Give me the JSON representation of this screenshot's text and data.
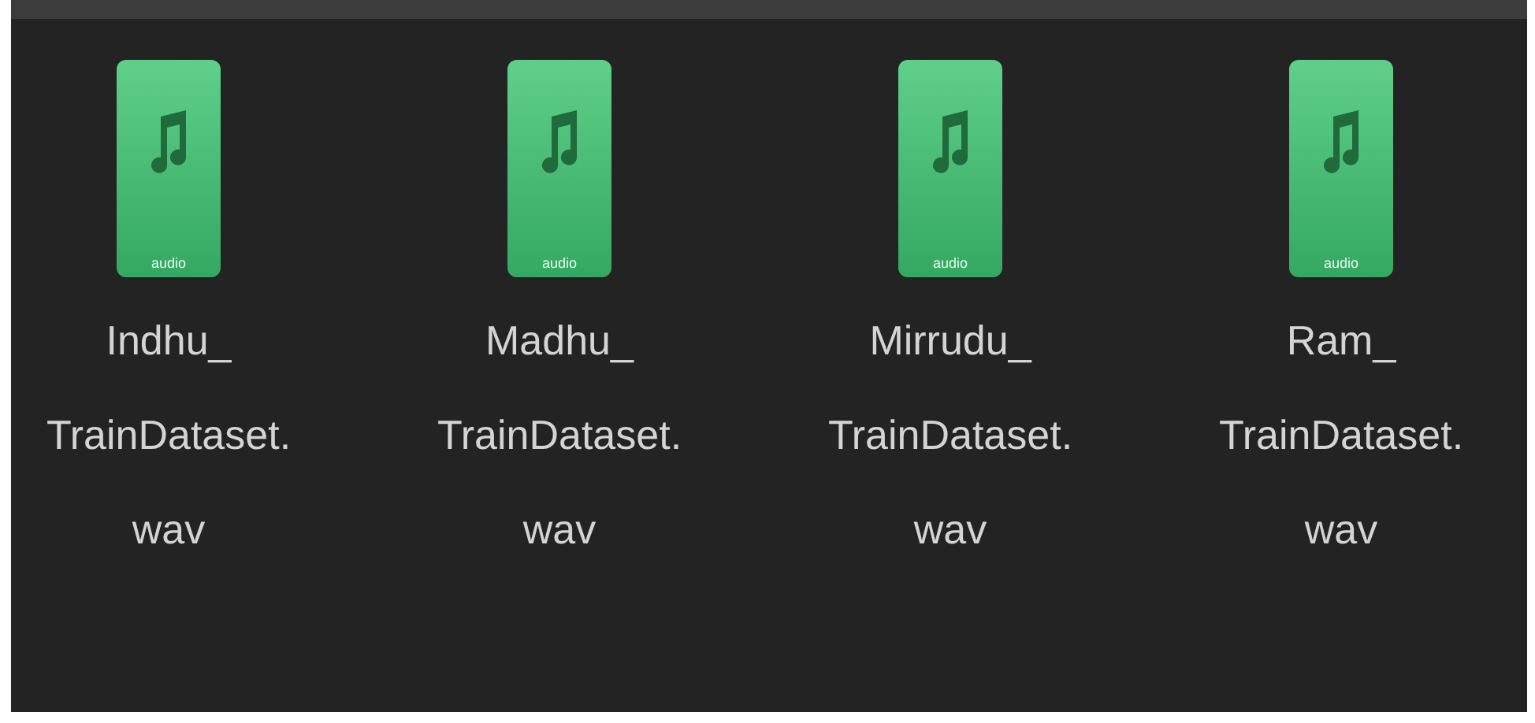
{
  "files": [
    {
      "name_lines": [
        "Indhu_",
        "TrainDataset.",
        "wav"
      ],
      "icon_label": "audio",
      "selected": false
    },
    {
      "name_lines": [
        "Madhu_",
        "TrainDataset.",
        "wav"
      ],
      "icon_label": "audio",
      "selected": false
    },
    {
      "name_lines": [
        "Mirrudu_",
        "TrainDataset.",
        "wav"
      ],
      "icon_label": "audio",
      "selected": false
    },
    {
      "name_lines": [
        "Ram_",
        "TrainDataset.",
        "wav"
      ],
      "icon_label": "audio",
      "selected": false
    }
  ]
}
